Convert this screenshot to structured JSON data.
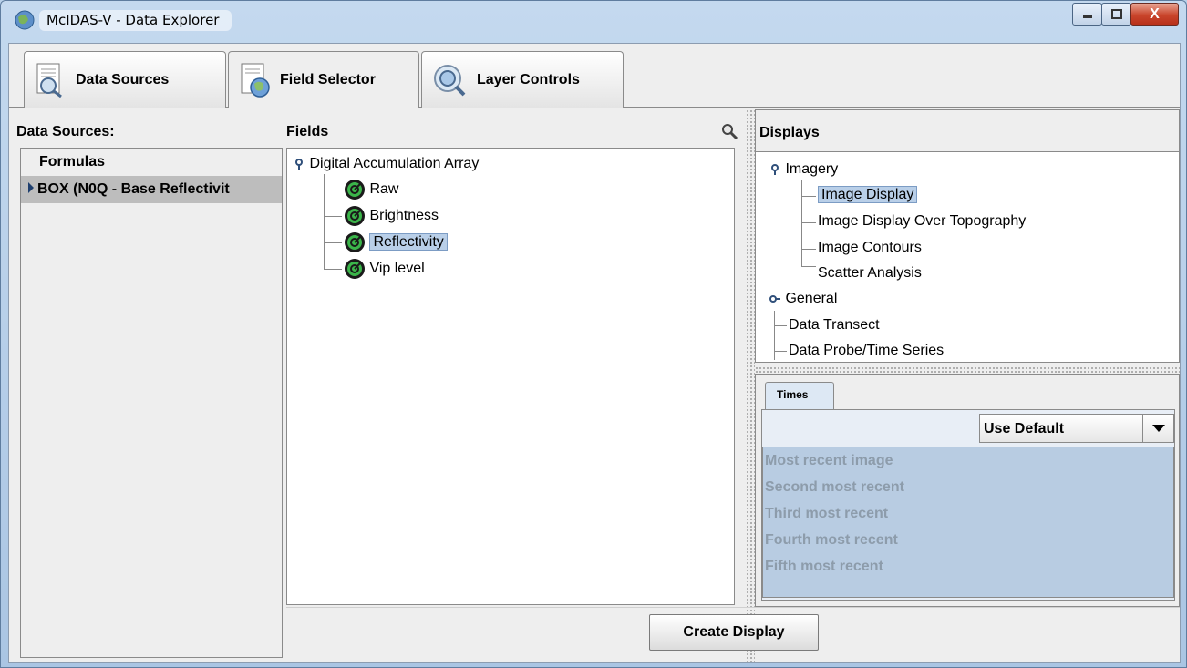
{
  "window": {
    "title": "McIDAS-V - Data Explorer",
    "close_glyph": "X"
  },
  "tabs": [
    {
      "label": "Data Sources",
      "icon": "data-sources-icon"
    },
    {
      "label": "Field Selector",
      "icon": "field-selector-icon"
    },
    {
      "label": "Layer Controls",
      "icon": "layer-controls-icon"
    }
  ],
  "data_sources": {
    "header": "Data Sources:",
    "items": [
      {
        "label": "Formulas"
      },
      {
        "label": "BOX (N0Q - Base Reflectivit"
      }
    ]
  },
  "fields": {
    "header": "Fields",
    "root": "Digital Accumulation Array",
    "items": [
      {
        "label": "Raw"
      },
      {
        "label": "Brightness"
      },
      {
        "label": "Reflectivity"
      },
      {
        "label": "Vip level"
      }
    ]
  },
  "displays": {
    "header": "Displays",
    "imagery": "Imagery",
    "imagery_items": [
      {
        "label": "Image Display"
      },
      {
        "label": "Image Display Over Topography"
      },
      {
        "label": "Image Contours"
      },
      {
        "label": "Scatter Analysis"
      }
    ],
    "general": "General",
    "other_items": [
      {
        "label": "Data Transect"
      },
      {
        "label": "Data Probe/Time Series"
      }
    ]
  },
  "times": {
    "tab_label": "Times",
    "selector_value": "Use Default",
    "items": [
      "Most recent image",
      "Second most recent",
      "Third most recent",
      "Fourth most recent",
      "Fifth most recent"
    ]
  },
  "buttons": {
    "create_display": "Create Display"
  }
}
